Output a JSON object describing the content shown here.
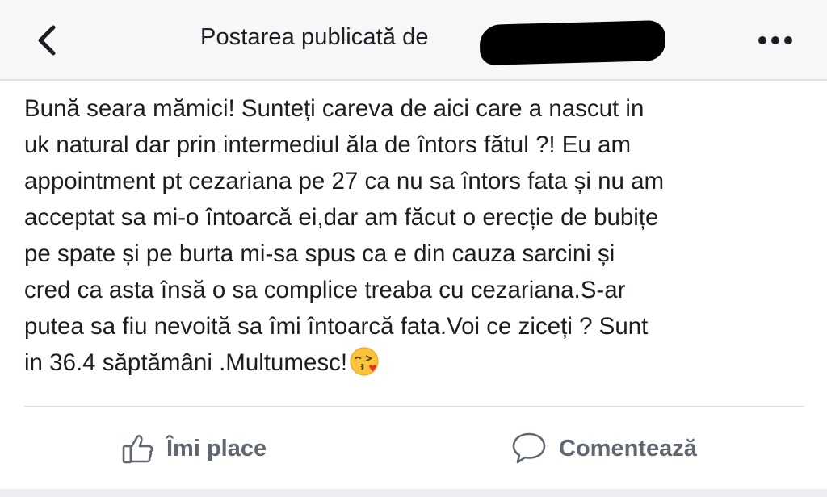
{
  "header": {
    "title": "Postarea publicată de",
    "back_icon": "chevron-left-icon",
    "more_icon": "more-horizontal-icon"
  },
  "post": {
    "text": "Bună seara mămici! Sunteți careva de aici care a nascut in\nuk natural dar prin intermediul ăla de întors fătul ?! Eu am\nappointment pt cezariana pe 27 ca nu sa întors fata și nu am\nacceptat sa mi-o întoarcă ei,dar am făcut o erecție de bubițe\npe spate și pe burta mi-sa spus ca e din cauza sarcini și\ncred ca asta însă o sa complice treaba cu cezariana.S-ar\nputea sa fiu nevoită sa îmi întoarcă fata.Voi ce ziceți ? Sunt\nin 36.4 săptămâni .Multumesc!",
    "emoji": "face-throwing-kiss-emoji"
  },
  "actions": {
    "like_label": "Îmi place",
    "comment_label": "Comentează"
  },
  "colors": {
    "header_bg": "#f7f7f9",
    "text": "#1c1e21",
    "action_text": "#606770",
    "divider": "#dddfe2"
  }
}
